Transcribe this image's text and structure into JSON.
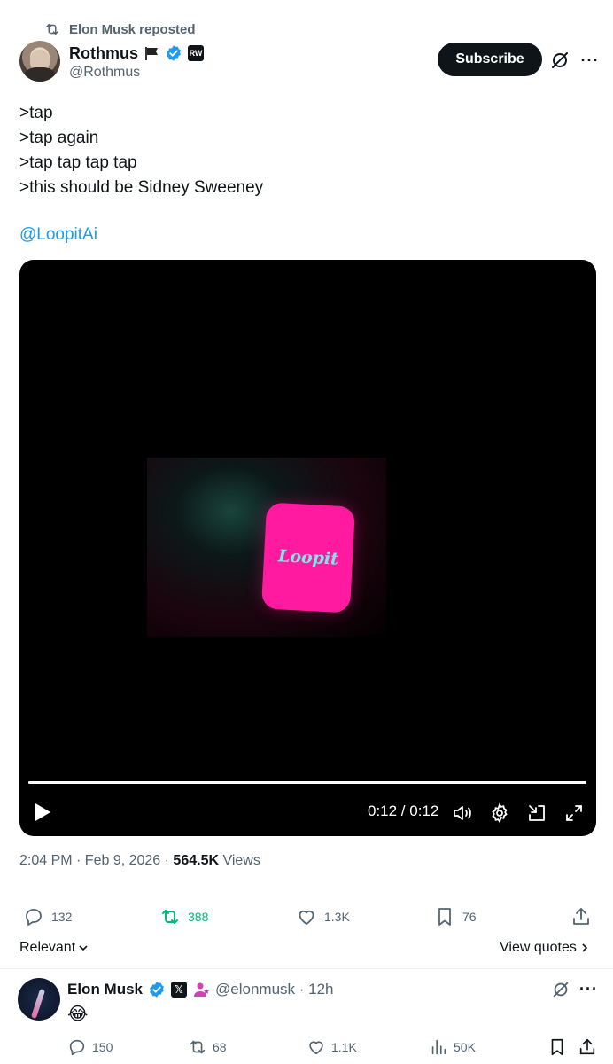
{
  "repost": {
    "label": "Elon Musk reposted"
  },
  "author": {
    "name": "Rothmus",
    "handle": "@Rothmus",
    "badge_text": "RW"
  },
  "subscribe_label": "Subscribe",
  "tweet": {
    "lines": [
      ">tap",
      ">tap again",
      ">tap tap tap tap",
      ">this should be Sidney Sweeney"
    ],
    "mention": "@LoopitAi"
  },
  "video": {
    "logo_text": "Loopit",
    "time": "0:12 / 0:12",
    "progress": 1.0
  },
  "meta": {
    "timestamp": "2:04 PM · Feb 9, 2026 · ",
    "views_count": "564.5K",
    "views_label": " Views"
  },
  "actions": {
    "replies": "132",
    "reposts": "388",
    "likes": "1.3K",
    "bookmarks": "76"
  },
  "sort": {
    "label": "Relevant"
  },
  "view_quotes": "View quotes",
  "reply": {
    "name": "Elon Musk",
    "handle_time": "@elonmusk · 12h",
    "text": "😂",
    "replies": "150",
    "reposts": "68",
    "likes": "1.1K",
    "views": "50K"
  },
  "colors": {
    "accent": "#1d9bf0",
    "repost_active": "#00ba7c",
    "brand_pink": "#ff1aa0",
    "text_secondary": "#536471"
  }
}
